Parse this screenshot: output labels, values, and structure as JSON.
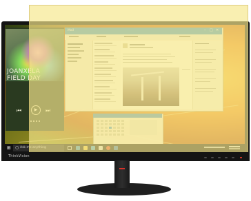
{
  "monitor": {
    "brand": "ThinkVision"
  },
  "media_player": {
    "album_title": "JOANXELA\nFIELD DAY",
    "controls": {
      "prev": "⏮",
      "play": "▶",
      "next": "⏭"
    }
  },
  "mail": {
    "app_name": "Mail",
    "window_controls": {
      "min": "–",
      "max": "□",
      "close": "✕"
    }
  },
  "taskbar": {
    "start_glyph": "⊞",
    "search_placeholder": "Ask me anything",
    "search_icon": "○"
  },
  "colors": {
    "overlay": "#f6e88c",
    "accent_blue": "#2f8fcf",
    "bezel": "#141414",
    "stand_accent": "#d6322a"
  }
}
